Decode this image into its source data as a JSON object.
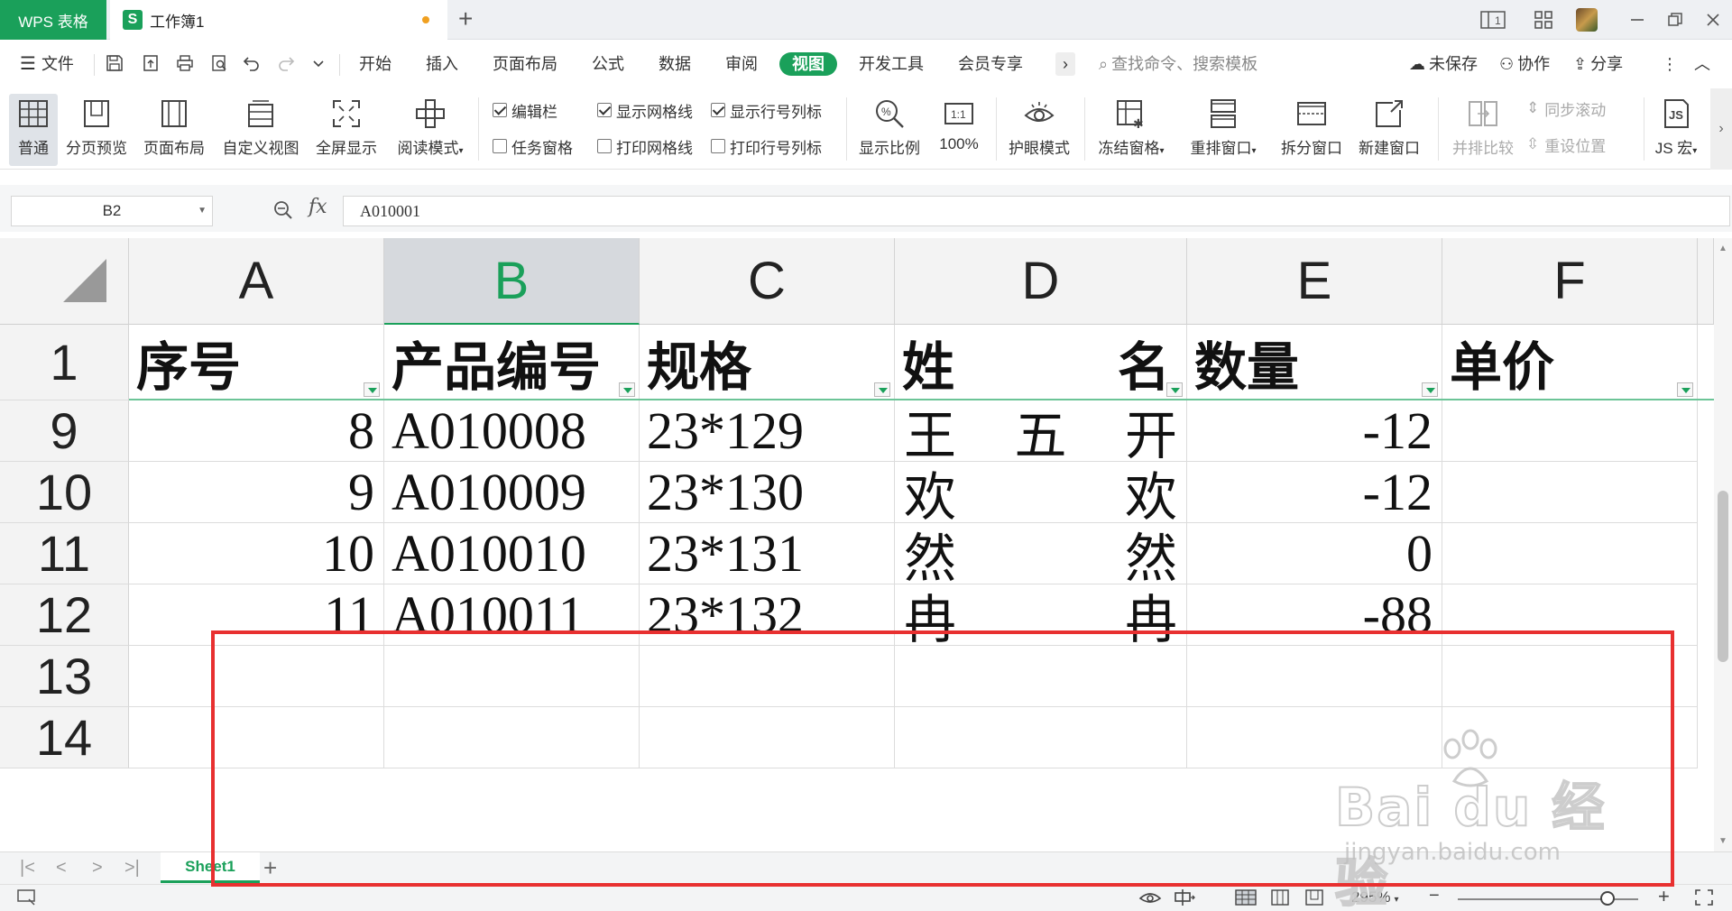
{
  "titlebar": {
    "app_label": "WPS 表格",
    "doc_icon": "S",
    "doc_title": "工作簿1",
    "new_tab": "+",
    "layout_badge": "1"
  },
  "menu": {
    "file": "文件",
    "tabs": [
      "开始",
      "插入",
      "页面布局",
      "公式",
      "数据",
      "审阅",
      "视图",
      "开发工具",
      "会员专享"
    ],
    "active_tab": "视图",
    "more": "›",
    "search_placeholder": "查找命令、搜索模板",
    "unsaved": "未保存",
    "collab": "协作",
    "share": "分享",
    "more_dots": "⋮",
    "collapse": "︿"
  },
  "ribbon": {
    "normal": "普通",
    "page_break": "分页预览",
    "page_layout": "页面布局",
    "custom_view": "自定义视图",
    "fullscreen": "全屏显示",
    "reading_mode": "阅读模式",
    "check_edit_bar": "编辑栏",
    "check_task_pane": "任务窗格",
    "check_show_grid": "显示网格线",
    "check_print_grid": "打印网格线",
    "check_show_headings": "显示行号列标",
    "check_print_headings": "打印行号列标",
    "zoom_ratio": "显示比例",
    "zoom_100": "100%",
    "eye_mode": "护眼模式",
    "freeze": "冻结窗格",
    "rearrange": "重排窗口",
    "split": "拆分窗口",
    "new_window": "新建窗口",
    "side_by_side": "并排比较",
    "sync_scroll": "同步滚动",
    "reset_pos": "重设位置",
    "js_macro": "JS 宏",
    "zoom_100_icon_text": "1:1",
    "js_icon_text": "JS"
  },
  "formula": {
    "cell_ref": "B2",
    "fx": "fx",
    "value": "A010001"
  },
  "grid": {
    "columns": [
      "A",
      "B",
      "C",
      "D",
      "E",
      "F"
    ],
    "selected_column": "B",
    "header_row": {
      "row_num": "1",
      "cells": [
        "序号",
        "产品编号",
        "规格",
        [
          "姓",
          "名"
        ],
        "数量",
        "单价"
      ]
    },
    "rows": [
      {
        "row_num": "9",
        "seq": "8",
        "code": "A010008",
        "spec": "23*129",
        "name": [
          "王",
          "五",
          "开"
        ],
        "qty": "-12"
      },
      {
        "row_num": "10",
        "seq": "9",
        "code": "A010009",
        "spec": "23*130",
        "name": [
          "欢",
          "欢"
        ],
        "qty": "-12"
      },
      {
        "row_num": "11",
        "seq": "10",
        "code": "A010010",
        "spec": "23*131",
        "name": [
          "然",
          "然"
        ],
        "qty": "0"
      },
      {
        "row_num": "12",
        "seq": "11",
        "code": "A010011",
        "spec": "23*132",
        "name": [
          "冉",
          "冉"
        ],
        "qty": "-88"
      },
      {
        "row_num": "13",
        "seq": "",
        "code": "",
        "spec": "",
        "name": [],
        "qty": ""
      },
      {
        "row_num": "14",
        "seq": "",
        "code": "",
        "spec": "",
        "name": [],
        "qty": ""
      }
    ]
  },
  "sheets": {
    "nav": [
      "|<",
      "<",
      ">",
      ">|"
    ],
    "tabs": [
      "Sheet1"
    ],
    "add": "+"
  },
  "status": {
    "zoom": "295%",
    "zoom_minus": "−",
    "zoom_plus": "+"
  },
  "watermark": {
    "main": "Bai du 经验",
    "sub": "jingyan.baidu.com"
  },
  "colors": {
    "accent": "#1aa05a",
    "highlight_box": "#e83030"
  }
}
